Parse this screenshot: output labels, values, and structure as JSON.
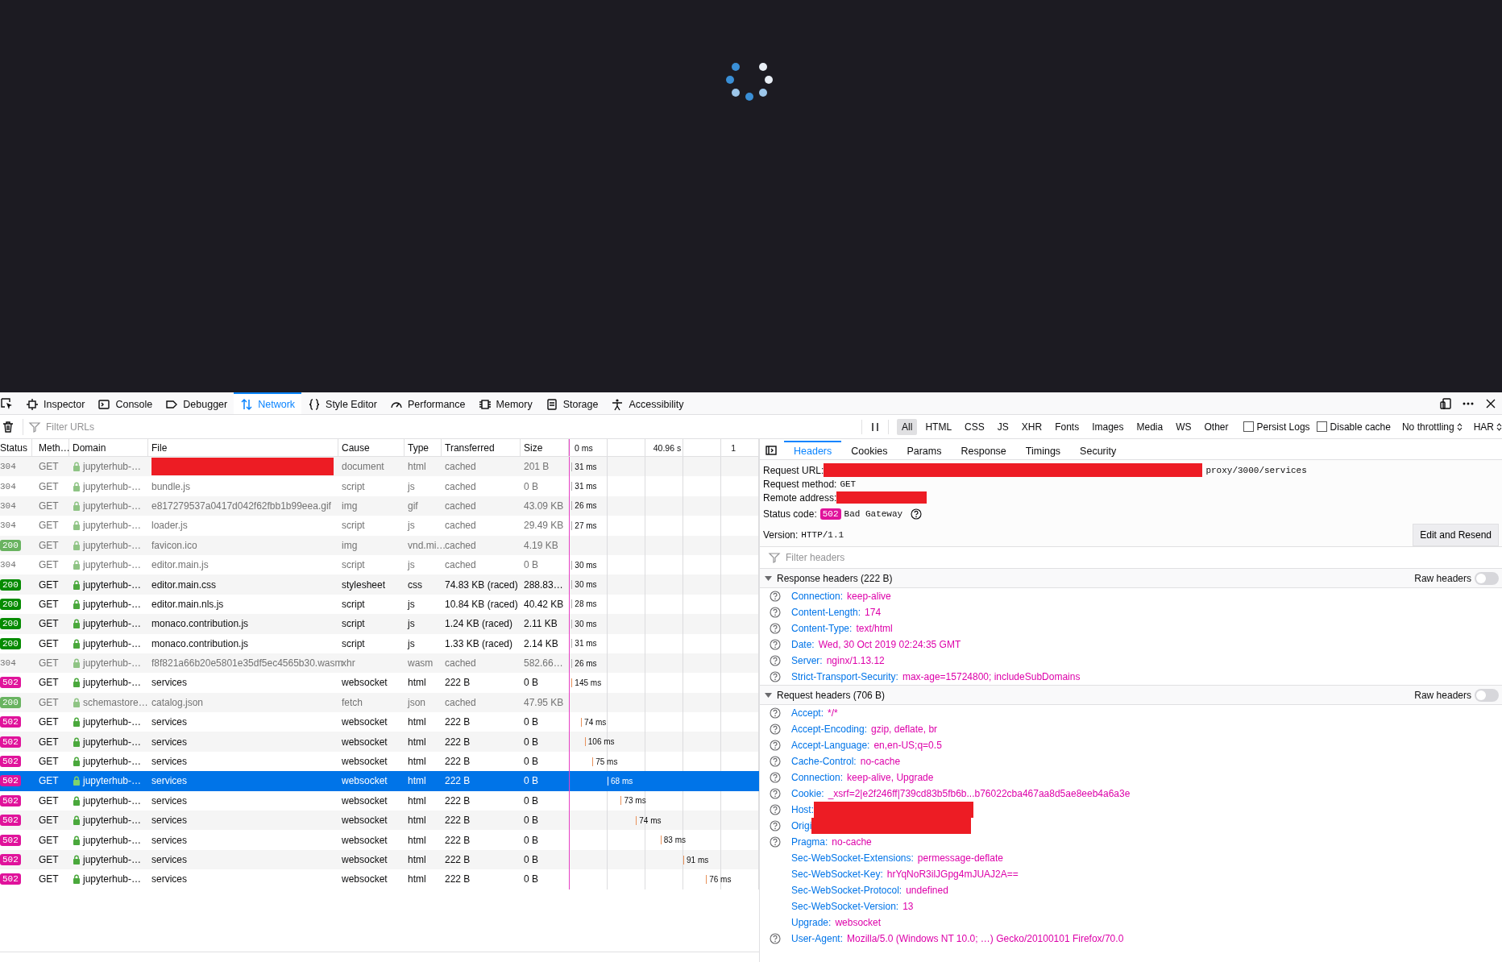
{
  "toolbar": {
    "tabs": [
      {
        "label": "Inspector",
        "selected": false
      },
      {
        "label": "Console",
        "selected": false
      },
      {
        "label": "Debugger",
        "selected": false
      },
      {
        "label": "Network",
        "selected": true
      },
      {
        "label": "Style Editor",
        "selected": false
      },
      {
        "label": "Performance",
        "selected": false
      },
      {
        "label": "Memory",
        "selected": false
      },
      {
        "label": "Storage",
        "selected": false
      },
      {
        "label": "Accessibility",
        "selected": false
      }
    ]
  },
  "filter_bar": {
    "placeholder": "Filter URLs",
    "type_filters": [
      {
        "label": "All",
        "selected": true
      },
      {
        "label": "HTML",
        "selected": false
      },
      {
        "label": "CSS",
        "selected": false
      },
      {
        "label": "JS",
        "selected": false
      },
      {
        "label": "XHR",
        "selected": false
      },
      {
        "label": "Fonts",
        "selected": false
      },
      {
        "label": "Images",
        "selected": false
      },
      {
        "label": "Media",
        "selected": false
      },
      {
        "label": "WS",
        "selected": false
      },
      {
        "label": "Other",
        "selected": false
      }
    ],
    "options": [
      {
        "label": "Persist Logs",
        "checked": false
      },
      {
        "label": "Disable cache",
        "checked": false
      }
    ],
    "selects": [
      "No throttling",
      "HAR"
    ]
  },
  "requests": {
    "columns": [
      "Status",
      "Meth…",
      "Domain",
      "File",
      "Cause",
      "Type",
      "Transferred",
      "Size"
    ],
    "waterfall_ticks": [
      "0 ms",
      "40.96 s",
      "1"
    ],
    "rows": [
      {
        "status": "304",
        "kind": "plain",
        "method": "GET",
        "domain": "jupyterhub-…",
        "redacted": true,
        "cause": "document",
        "type": "html",
        "transferred": "cached",
        "size": "201 B",
        "timing": "31 ms",
        "level": 0.01,
        "muted": true,
        "selected": false
      },
      {
        "status": "304",
        "kind": "plain",
        "method": "GET",
        "domain": "jupyterhub-…",
        "file": "bundle.js",
        "cause": "script",
        "type": "js",
        "transferred": "cached",
        "size": "0 B",
        "timing": "31 ms",
        "level": 0.01,
        "muted": true,
        "selected": false
      },
      {
        "status": "304",
        "kind": "plain",
        "method": "GET",
        "domain": "jupyterhub-…",
        "file": "e817279537a0417d042f62fbb1b99eea.gif",
        "cause": "img",
        "type": "gif",
        "transferred": "cached",
        "size": "43.09 KB",
        "timing": "26 ms",
        "level": 0.01,
        "muted": true,
        "selected": false
      },
      {
        "status": "304",
        "kind": "plain",
        "method": "GET",
        "domain": "jupyterhub-…",
        "file": "loader.js",
        "cause": "script",
        "type": "js",
        "transferred": "cached",
        "size": "29.49 KB",
        "timing": "27 ms",
        "level": 0.01,
        "muted": true,
        "selected": false
      },
      {
        "status": "200",
        "kind": "ok",
        "method": "GET",
        "domain": "jupyterhub-…",
        "file": "favicon.ico",
        "cause": "img",
        "type": "vnd.mi…",
        "transferred": "cached",
        "size": "4.19 KB",
        "muted": true,
        "selected": false
      },
      {
        "status": "304",
        "kind": "plain",
        "method": "GET",
        "domain": "jupyterhub-…",
        "file": "editor.main.js",
        "cause": "script",
        "type": "js",
        "transferred": "cached",
        "size": "0 B",
        "timing": "30 ms",
        "level": 0.01,
        "muted": true,
        "selected": false
      },
      {
        "status": "200",
        "kind": "ok",
        "method": "GET",
        "domain": "jupyterhub-…",
        "file": "editor.main.css",
        "cause": "stylesheet",
        "type": "css",
        "transferred": "74.83 KB (raced)",
        "size": "288.83…",
        "timing": "30 ms",
        "level": 0.01,
        "muted": false,
        "selected": false
      },
      {
        "status": "200",
        "kind": "ok",
        "method": "GET",
        "domain": "jupyterhub-…",
        "file": "editor.main.nls.js",
        "cause": "script",
        "type": "js",
        "transferred": "10.84 KB (raced)",
        "size": "40.42 KB",
        "timing": "28 ms",
        "level": 0.01,
        "muted": false,
        "selected": false
      },
      {
        "status": "200",
        "kind": "ok",
        "method": "GET",
        "domain": "jupyterhub-…",
        "file": "monaco.contribution.js",
        "cause": "script",
        "type": "js",
        "transferred": "1.24 KB (raced)",
        "size": "2.11 KB",
        "timing": "30 ms",
        "level": 0.01,
        "muted": false,
        "selected": false
      },
      {
        "status": "200",
        "kind": "ok",
        "method": "GET",
        "domain": "jupyterhub-…",
        "file": "monaco.contribution.js",
        "cause": "script",
        "type": "js",
        "transferred": "1.33 KB (raced)",
        "size": "2.14 KB",
        "timing": "31 ms",
        "level": 0.01,
        "muted": false,
        "selected": false
      },
      {
        "status": "304",
        "kind": "plain",
        "method": "GET",
        "domain": "jupyterhub-…",
        "file": "f8f821a66b20e5801e35df5ec4565b30.wasm",
        "cause": "xhr",
        "type": "wasm",
        "transferred": "cached",
        "size": "582.66…",
        "timing": "26 ms",
        "level": 0.01,
        "muted": true,
        "selected": false
      },
      {
        "status": "502",
        "kind": "error",
        "method": "GET",
        "domain": "jupyterhub-…",
        "file": "services",
        "cause": "websocket",
        "type": "html",
        "transferred": "222 B",
        "size": "0 B",
        "timing": "145 ms",
        "level": 0.01,
        "muted": false,
        "selected": false
      },
      {
        "status": "200",
        "kind": "ok",
        "method": "GET",
        "domain": "schemastore…",
        "file": "catalog.json",
        "cause": "fetch",
        "type": "json",
        "transferred": "cached",
        "size": "47.95 KB",
        "muted": true,
        "selected": false
      },
      {
        "status": "502",
        "kind": "error",
        "method": "GET",
        "domain": "jupyterhub-…",
        "file": "services",
        "cause": "websocket",
        "type": "html",
        "transferred": "222 B",
        "size": "0 B",
        "timing": "74 ms",
        "level": 0.06,
        "muted": false,
        "selected": false
      },
      {
        "status": "502",
        "kind": "error",
        "method": "GET",
        "domain": "jupyterhub-…",
        "file": "services",
        "cause": "websocket",
        "type": "html",
        "transferred": "222 B",
        "size": "0 B",
        "timing": "106 ms",
        "level": 0.08,
        "muted": false,
        "selected": false
      },
      {
        "status": "502",
        "kind": "error",
        "method": "GET",
        "domain": "jupyterhub-…",
        "file": "services",
        "cause": "websocket",
        "type": "html",
        "transferred": "222 B",
        "size": "0 B",
        "timing": "75 ms",
        "level": 0.12,
        "muted": false,
        "selected": false
      },
      {
        "status": "502",
        "kind": "error",
        "method": "GET",
        "domain": "jupyterhub-…",
        "file": "services",
        "cause": "websocket",
        "type": "html",
        "transferred": "222 B",
        "size": "0 B",
        "timing": "68 ms",
        "level": 0.2,
        "muted": false,
        "selected": true
      },
      {
        "status": "502",
        "kind": "error",
        "method": "GET",
        "domain": "jupyterhub-…",
        "file": "services",
        "cause": "websocket",
        "type": "html",
        "transferred": "222 B",
        "size": "0 B",
        "timing": "73 ms",
        "level": 0.27,
        "muted": false,
        "selected": false
      },
      {
        "status": "502",
        "kind": "error",
        "method": "GET",
        "domain": "jupyterhub-…",
        "file": "services",
        "cause": "websocket",
        "type": "html",
        "transferred": "222 B",
        "size": "0 B",
        "timing": "74 ms",
        "level": 0.35,
        "muted": false,
        "selected": false
      },
      {
        "status": "502",
        "kind": "error",
        "method": "GET",
        "domain": "jupyterhub-…",
        "file": "services",
        "cause": "websocket",
        "type": "html",
        "transferred": "222 B",
        "size": "0 B",
        "timing": "83 ms",
        "level": 0.48,
        "muted": false,
        "selected": false
      },
      {
        "status": "502",
        "kind": "error",
        "method": "GET",
        "domain": "jupyterhub-…",
        "file": "services",
        "cause": "websocket",
        "type": "html",
        "transferred": "222 B",
        "size": "0 B",
        "timing": "91 ms",
        "level": 0.6,
        "muted": false,
        "selected": false
      },
      {
        "status": "502",
        "kind": "error",
        "method": "GET",
        "domain": "jupyterhub-…",
        "file": "services",
        "cause": "websocket",
        "type": "html",
        "transferred": "222 B",
        "size": "0 B",
        "timing": "76 ms",
        "level": 0.72,
        "muted": false,
        "selected": false
      }
    ]
  },
  "details": {
    "tabs": [
      {
        "label": "Headers",
        "selected": true
      },
      {
        "label": "Cookies",
        "selected": false
      },
      {
        "label": "Params",
        "selected": false
      },
      {
        "label": "Response",
        "selected": false
      },
      {
        "label": "Timings",
        "selected": false
      },
      {
        "label": "Security",
        "selected": false
      }
    ],
    "summary": [
      {
        "label": "Request URL:",
        "value": "proxy/3000/services",
        "redacted": true,
        "kind": "url"
      },
      {
        "label": "Request method:",
        "value": "GET",
        "redacted": false
      },
      {
        "label": "Remote address:",
        "redacted": true,
        "kind": "address"
      }
    ],
    "status": {
      "label": "Status code:",
      "code": "502",
      "kind": "error",
      "text": "Bad Gateway"
    },
    "version": {
      "label": "Version:",
      "value": "HTTP/1.1"
    },
    "resend_button": "Edit and Resend",
    "filter_placeholder": "Filter headers",
    "sections": [
      {
        "title": "Response headers (222 B)",
        "expanded": true,
        "raw_label": "Raw headers",
        "raw_on": false,
        "headers": [
          {
            "name": "Connection:",
            "value": "keep-alive",
            "help": true
          },
          {
            "name": "Content-Length:",
            "value": "174",
            "help": true
          },
          {
            "name": "Content-Type:",
            "value": "text/html",
            "help": true
          },
          {
            "name": "Date:",
            "value": "Wed, 30 Oct 2019 02:24:35 GMT",
            "help": true
          },
          {
            "name": "Server:",
            "value": "nginx/1.13.12",
            "help": true
          },
          {
            "name": "Strict-Transport-Security:",
            "value": "max-age=15724800; includeSubDomains",
            "help": true
          }
        ]
      },
      {
        "title": "Request headers (706 B)",
        "expanded": true,
        "raw_label": "Raw headers",
        "raw_on": false,
        "headers": [
          {
            "name": "Accept:",
            "value": "*/*",
            "help": true
          },
          {
            "name": "Accept-Encoding:",
            "value": "gzip, deflate, br",
            "help": true
          },
          {
            "name": "Accept-Language:",
            "value": "en,en-US;q=0.5",
            "help": true
          },
          {
            "name": "Cache-Control:",
            "value": "no-cache",
            "help": true
          },
          {
            "name": "Connection:",
            "value": "keep-alive, Upgrade",
            "help": true
          },
          {
            "name": "Cookie:",
            "value": "_xsrf=2|e2f246ff|739cd83b5fb6b...b76022cba467aa8d5ae8eeb4a6a3e",
            "help": true
          },
          {
            "name": "Host:",
            "redacted": true,
            "help": true
          },
          {
            "name": "Origi",
            "redacted": true,
            "help": true
          },
          {
            "name": "Pragma:",
            "value": "no-cache",
            "help": true
          },
          {
            "name": "Sec-WebSocket-Extensions:",
            "value": "permessage-deflate",
            "help": false
          },
          {
            "name": "Sec-WebSocket-Key:",
            "value": "hrYqNoR3ilJGpg4mJUAJ2A==",
            "help": false
          },
          {
            "name": "Sec-WebSocket-Protocol:",
            "value": "undefined",
            "help": false
          },
          {
            "name": "Sec-WebSocket-Version:",
            "value": "13",
            "help": false
          },
          {
            "name": "Upgrade:",
            "value": "websocket",
            "help": false
          },
          {
            "name": "User-Agent:",
            "value": "Mozilla/5.0 (Windows NT 10.0; …) Gecko/20100101 Firefox/70.0",
            "help": true
          }
        ]
      }
    ]
  }
}
